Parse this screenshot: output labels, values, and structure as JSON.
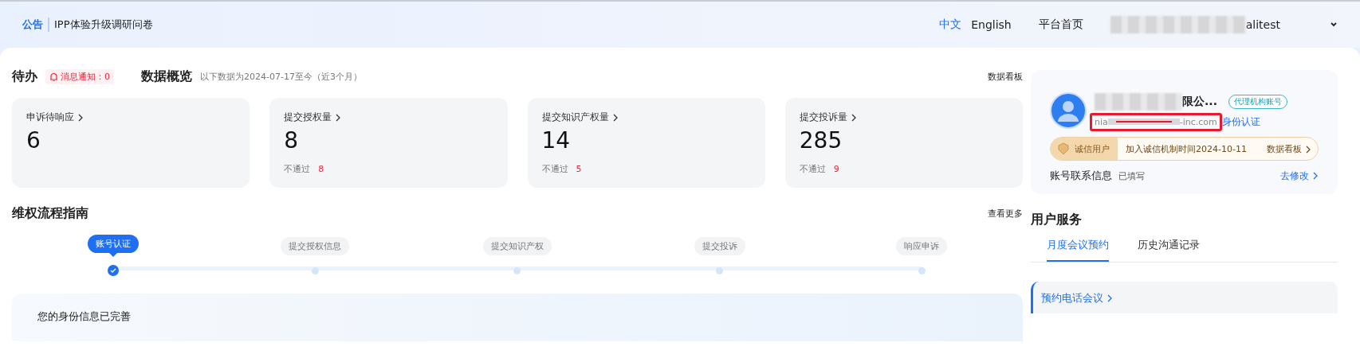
{
  "announcement": {
    "tag": "公告",
    "text": "IPP体验升级调研问卷"
  },
  "top_nav": {
    "languages": [
      {
        "label": "中文",
        "selected": true
      },
      {
        "label": "English",
        "selected": false
      }
    ],
    "home": "平台首页",
    "user": "alitest"
  },
  "todo": {
    "title": "待办",
    "notice": "消息通知：0"
  },
  "overview": {
    "title": "数据概览",
    "subtitle": "以下数据为2024-07-17至今（近3个月）",
    "link": "数据看板",
    "cards": [
      {
        "label": "申诉待响应",
        "value": "6"
      },
      {
        "label": "提交授权量",
        "value": "8",
        "fail_label": "不通过",
        "fail_value": "8"
      },
      {
        "label": "提交知识产权量",
        "value": "14",
        "fail_label": "不通过",
        "fail_value": "5"
      },
      {
        "label": "提交投诉量",
        "value": "285",
        "fail_label": "不通过",
        "fail_value": "9"
      }
    ]
  },
  "guide": {
    "title": "维权流程指南",
    "link": "查看更多",
    "steps": [
      {
        "label": "账号认证",
        "selected": true
      },
      {
        "label": "提交授权信息",
        "selected": false
      },
      {
        "label": "提交知识产权",
        "selected": false
      },
      {
        "label": "提交投诉",
        "selected": false
      },
      {
        "label": "响应申诉",
        "selected": false
      }
    ],
    "message": "您的身份信息已完善"
  },
  "account": {
    "company": "限公...",
    "badge": "代理机构账号",
    "email": "nia",
    "email_end": "-inc.com",
    "verify": "身份认证",
    "credit": {
      "label": "诚信用户",
      "joined": "加入诚信机制时间2024-10-11",
      "link": "数据看板"
    },
    "contact_label": "账号联系信息",
    "contact_status": "已填写",
    "edit": "去修改"
  },
  "services": {
    "title": "用户服务",
    "tabs": [
      {
        "label": "月度会议预约",
        "selected": true
      },
      {
        "label": "历史沟通记录",
        "selected": false
      }
    ],
    "items": [
      {
        "label": "预约电话会议"
      }
    ]
  }
}
